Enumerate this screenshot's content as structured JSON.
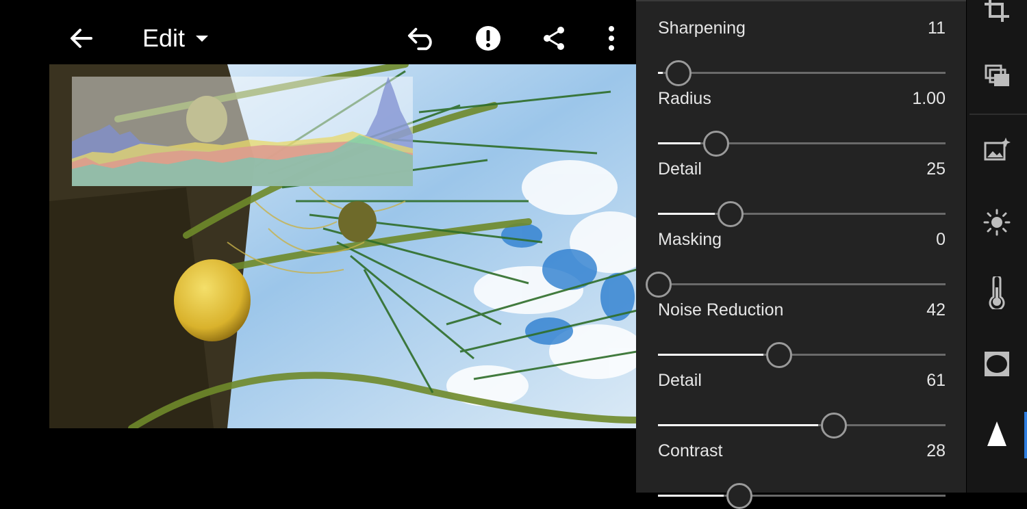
{
  "header": {
    "title": "Edit",
    "icons": [
      "back-arrow-icon",
      "dropdown-caret-icon",
      "undo-icon",
      "alert-icon",
      "share-icon",
      "more-vertical-icon"
    ]
  },
  "detail_panel": {
    "sliders": [
      {
        "label": "Sharpening",
        "value": "11",
        "level": 0.07
      },
      {
        "label": "Radius",
        "value": "1.00",
        "level": 0.2
      },
      {
        "label": "Detail",
        "value": "25",
        "level": 0.25
      },
      {
        "label": "Masking",
        "value": "0",
        "level": 0.0
      },
      {
        "label": "Noise Reduction",
        "value": "42",
        "level": 0.42
      },
      {
        "label": "Detail",
        "value": "61",
        "level": 0.61
      },
      {
        "label": "Contrast",
        "value": "28",
        "level": 0.28
      }
    ]
  },
  "toolstrip": {
    "tools": [
      "crop-icon",
      "presets-icon",
      "auto-enhance-icon",
      "light-icon",
      "color-temperature-icon",
      "effects-vignette-icon",
      "detail-icon"
    ],
    "active": "detail-icon"
  },
  "colors": {
    "accent": "#2d7de0",
    "panel": "#232323",
    "toolstrip": "#161616"
  }
}
